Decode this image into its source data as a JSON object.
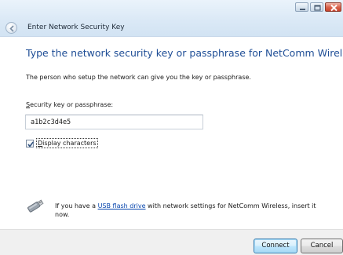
{
  "window": {
    "title": "Enter Network Security Key",
    "caption_buttons": [
      "minimize",
      "maximize",
      "close"
    ]
  },
  "main": {
    "heading": "Type the network security key or passphrase for NetComm Wireless",
    "description": "The person who setup the network can give you the key or passphrase.",
    "key_label_accel": "S",
    "key_label_rest": "ecurity key or passphrase:",
    "key_value": "a1b2c3d4e5",
    "display_chars_checked": true,
    "display_chars_accel": "D",
    "display_chars_rest": "isplay characters"
  },
  "usb": {
    "icon": "usb-flash-drive-icon",
    "text_before": "If you have a ",
    "link_text": "USB flash drive",
    "text_after": " with network settings for NetComm Wireless, insert it now."
  },
  "footer": {
    "connect_label": "Connect",
    "cancel_label": "Cancel"
  },
  "colors": {
    "heading": "#1f4e96",
    "link": "#0645ad",
    "titlebar": "#dbe9f6",
    "footer": "#f0f0f0"
  }
}
